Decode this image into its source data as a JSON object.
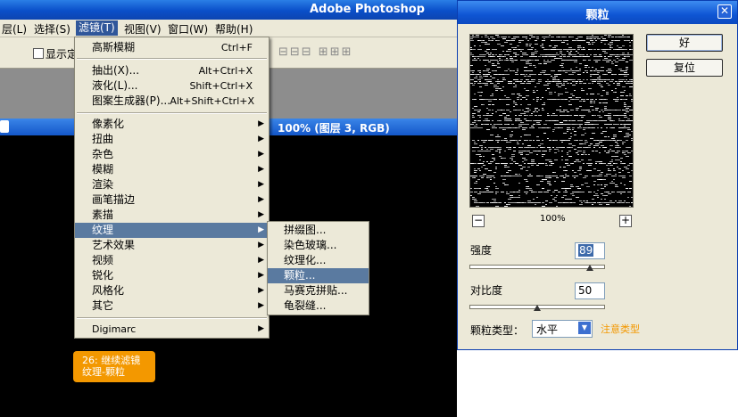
{
  "app": {
    "title": "Adobe Photoshop"
  },
  "menubar": {
    "items": [
      "层(L)",
      "选择(S)",
      "滤镜(T)",
      "视图(V)",
      "窗口(W)",
      "帮助(H)"
    ]
  },
  "options": {
    "show_label": "显示定"
  },
  "document": {
    "title_visible": "100% (图层 3, RGB)"
  },
  "filter_menu": {
    "top": [
      {
        "label": "高斯模糊",
        "shortcut": "Ctrl+F"
      }
    ],
    "group2": [
      {
        "label": "抽出(X)...",
        "shortcut": "Alt+Ctrl+X"
      },
      {
        "label": "液化(L)...",
        "shortcut": "Shift+Ctrl+X"
      },
      {
        "label": "图案生成器(P)...",
        "shortcut": "Alt+Shift+Ctrl+X"
      }
    ],
    "group3": [
      "像素化",
      "扭曲",
      "杂色",
      "模糊",
      "渲染",
      "画笔描边",
      "素描",
      "纹理",
      "艺术效果",
      "视频",
      "锐化",
      "风格化",
      "其它"
    ],
    "highlighted": "纹理",
    "group4": [
      "Digimarc"
    ]
  },
  "texture_menu": {
    "items": [
      "拼缀图...",
      "染色玻璃...",
      "纹理化...",
      "颗粒...",
      "马赛克拼贴...",
      "龟裂缝..."
    ],
    "highlighted": "颗粒..."
  },
  "caption": {
    "line1": "26: 继续滤镜",
    "line2": "纹理-颗粒"
  },
  "dialog": {
    "title": "颗粒",
    "ok_label": "好",
    "reset_label": "复位",
    "zoom": "100%",
    "zoom_out": "−",
    "zoom_in": "+",
    "intensity_label": "强度",
    "intensity_value": "89",
    "intensity_fraction": 0.89,
    "contrast_label": "对比度",
    "contrast_value": "50",
    "contrast_fraction": 0.5,
    "grain_type_label": "颗粒类型：",
    "grain_type_value": "水平",
    "note": "注意类型"
  },
  "colors": {
    "accent_orange": "#f39800",
    "menu_highlight": "#5a7aa0",
    "title_blue": "#0a4fc9"
  }
}
